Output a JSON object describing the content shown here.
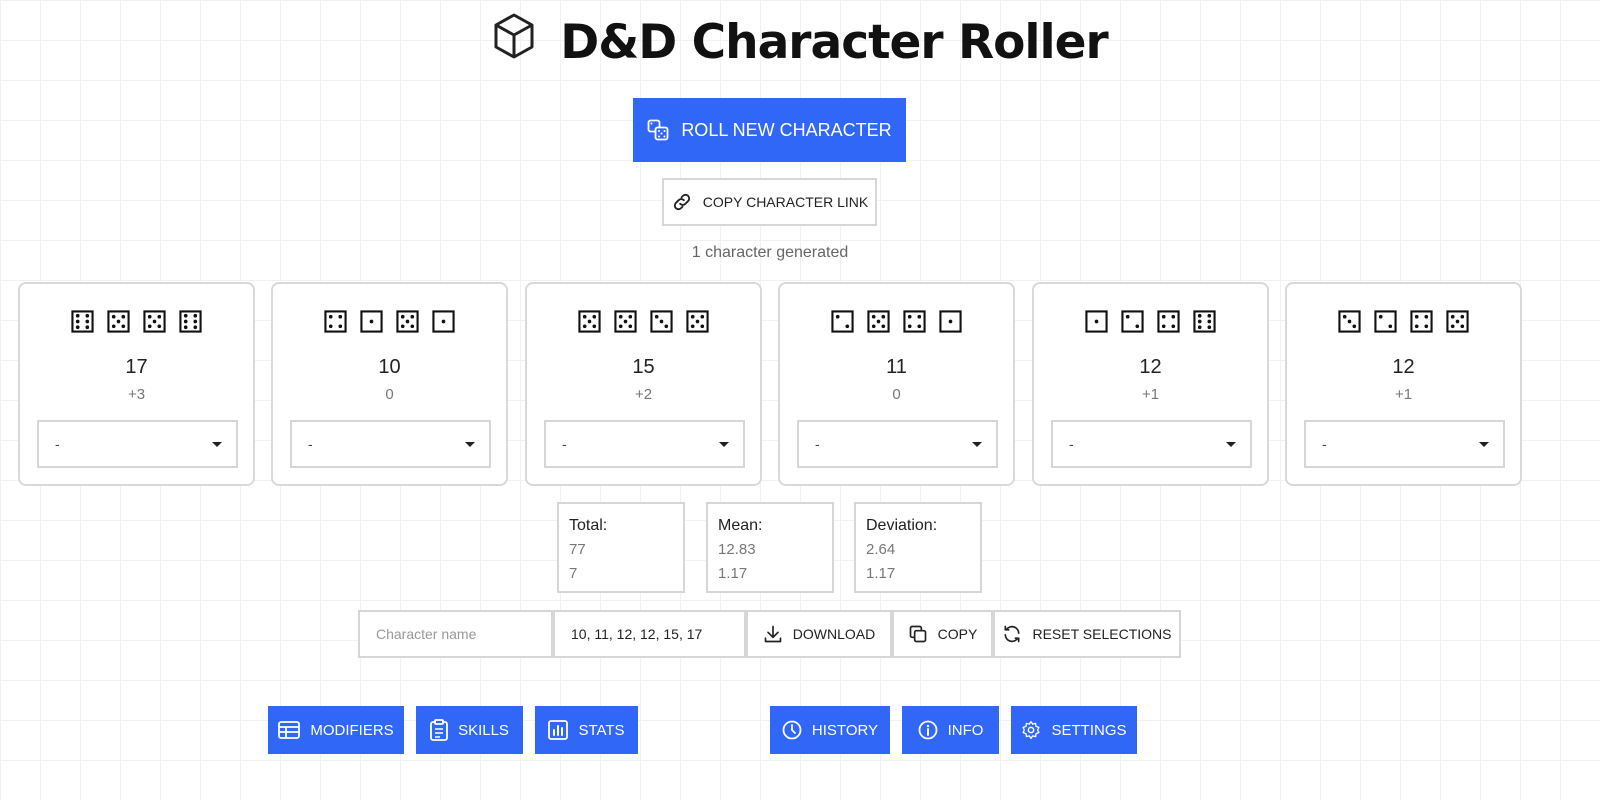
{
  "header": {
    "title": "D&D Character Roller",
    "logo_icon": "cube-icon"
  },
  "actions": {
    "roll_label": "ROLL NEW CHARACTER",
    "copy_link_label": "COPY CHARACTER LINK",
    "generated_text": "1 character generated"
  },
  "abilities": [
    {
      "dice": [
        6,
        5,
        5,
        6
      ],
      "score": "17",
      "modifier": "+3",
      "select_value": "-"
    },
    {
      "dice": [
        4,
        1,
        5,
        1
      ],
      "score": "10",
      "modifier": "0",
      "select_value": "-"
    },
    {
      "dice": [
        5,
        5,
        3,
        5
      ],
      "score": "15",
      "modifier": "+2",
      "select_value": "-"
    },
    {
      "dice": [
        2,
        5,
        4,
        1
      ],
      "score": "11",
      "modifier": "0",
      "select_value": "-"
    },
    {
      "dice": [
        1,
        2,
        4,
        6
      ],
      "score": "12",
      "modifier": "+1",
      "select_value": "-"
    },
    {
      "dice": [
        3,
        2,
        4,
        5
      ],
      "score": "12",
      "modifier": "+1",
      "select_value": "-"
    }
  ],
  "stats": {
    "total": {
      "label": "Total:",
      "value": "77",
      "secondary": "7"
    },
    "mean": {
      "label": "Mean:",
      "value": "12.83",
      "secondary": "1.17"
    },
    "deviation": {
      "label": "Deviation:",
      "value": "2.64",
      "secondary": "1.17"
    }
  },
  "toolbar": {
    "name_placeholder": "Character name",
    "scores_value": "10, 11, 12, 12, 15, 17",
    "download_label": "DOWNLOAD",
    "copy_label": "COPY",
    "reset_label": "RESET SELECTIONS"
  },
  "nav": {
    "modifiers": "MODIFIERS",
    "skills": "SKILLS",
    "stats": "STATS",
    "history": "HISTORY",
    "info": "INFO",
    "settings": "SETTINGS"
  },
  "colors": {
    "accent": "#3167f7",
    "border": "#d6d6d6"
  }
}
